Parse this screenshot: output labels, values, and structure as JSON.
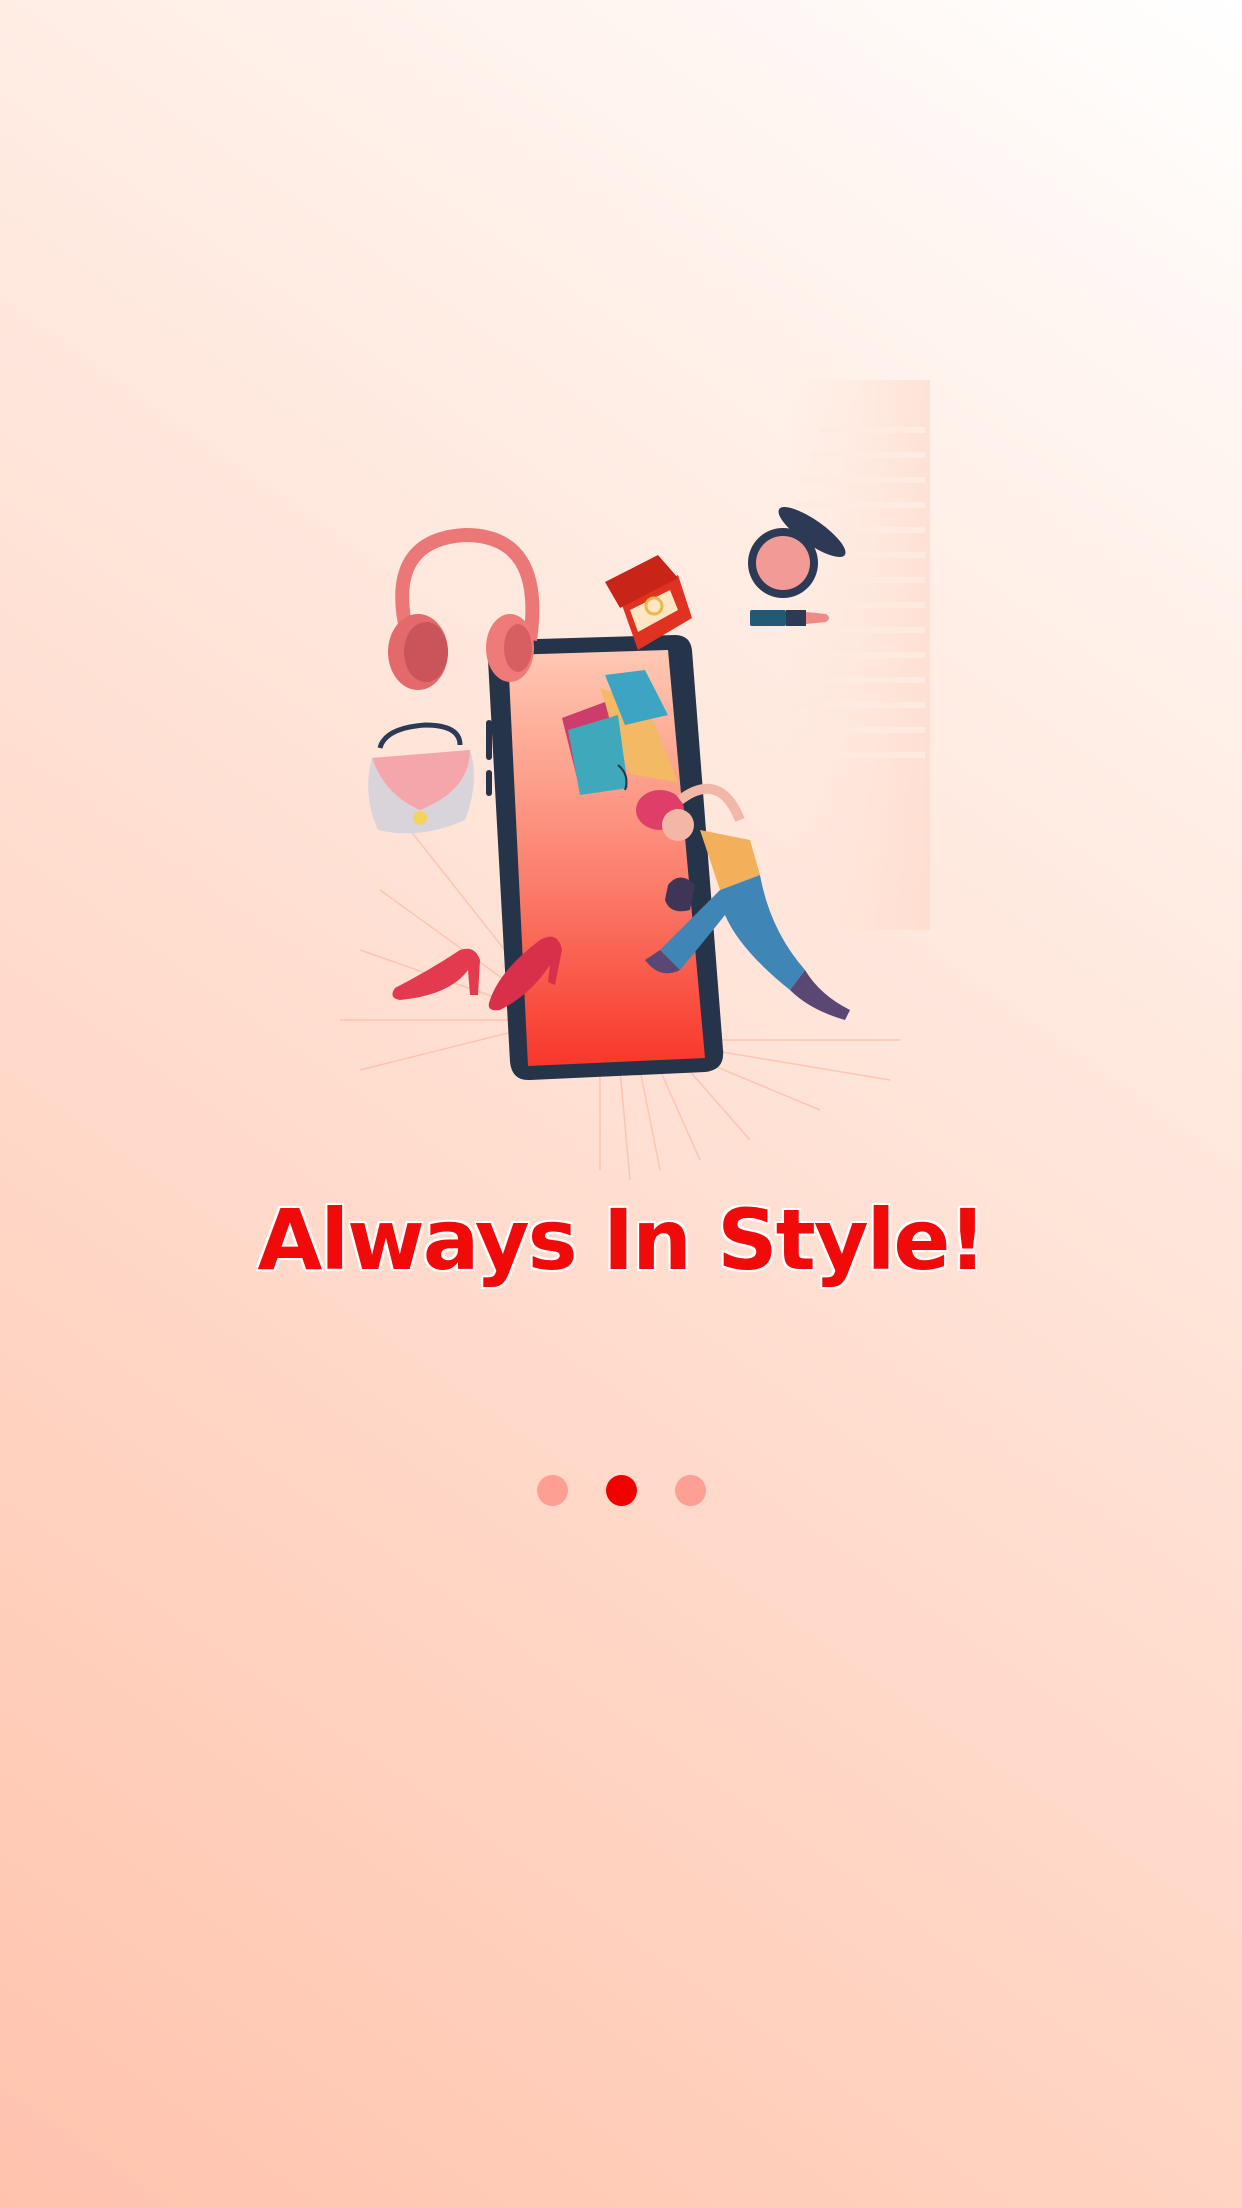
{
  "onboarding": {
    "headline": "Always In Style!",
    "illustration": {
      "name": "online-shopping-illustration",
      "elements": [
        "smartphone",
        "woman-with-shopping-bags",
        "headphones",
        "ring-box",
        "compact-mirror",
        "lipstick",
        "handbag",
        "high-heels"
      ]
    },
    "pager": {
      "total_pages": 3,
      "current_page": 2,
      "dots": [
        {
          "name": "page-dot-1",
          "active": false
        },
        {
          "name": "page-dot-2",
          "active": true
        },
        {
          "name": "page-dot-3",
          "active": false
        }
      ]
    }
  },
  "colors": {
    "accent": "#f20000",
    "inactive_dot": "#ff9e92",
    "background_top": "#ffffff",
    "background_bottom": "#ffc3ad"
  }
}
